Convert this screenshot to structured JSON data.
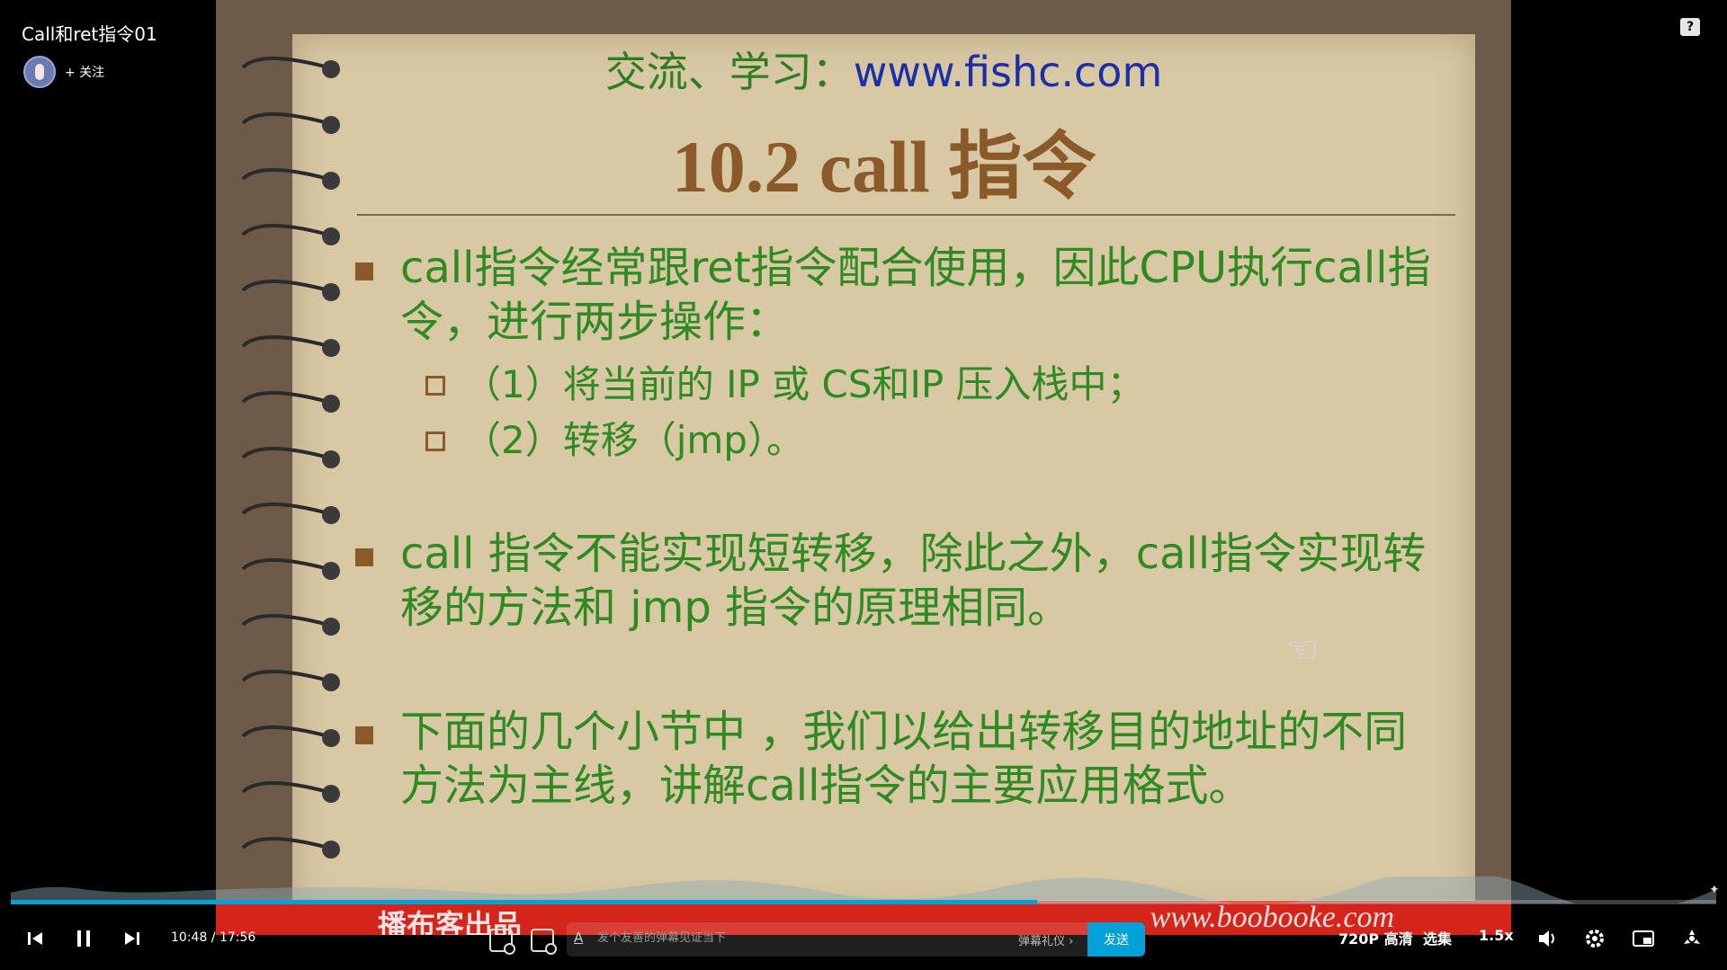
{
  "player": {
    "video_title": "Call和ret指令01",
    "follow_label": "+ 关注",
    "help_label": "?"
  },
  "slide": {
    "site_prefix": "交流、学习：",
    "site_url": "www.fishc.com",
    "heading": "10.2 call 指令",
    "bullets": [
      "call指令经常跟ret指令配合使用，因此CPU执行call指令，进行两步操作：",
      "call 指令不能实现短转移，除此之外，call指令实现转移的方法和 jmp 指令的原理相同。",
      "下面的几个小节中 ，我们以给出转移目的地址的不同方法为主线，讲解call指令的主要应用格式。"
    ],
    "sub_items": [
      "（1）将当前的 IP  或  CS和IP 压入栈中；",
      "（2）转移（jmp）。"
    ],
    "banner_left": "播布客出品",
    "banner_right": "www.boobooke.com"
  },
  "progress": {
    "current_time": "10:48",
    "separator": "/",
    "total_time": "17:56",
    "fraction": 0.602
  },
  "danmu": {
    "placeholder": "发个友善的弹幕见证当下",
    "etiquette_label": "弹幕礼仪 ›",
    "send_label": "发送",
    "a_icon": "A"
  },
  "controls": {
    "quality": "720P 高清",
    "episodes": "选集",
    "speed": "1.5x"
  },
  "colors": {
    "accent": "#00a1d6",
    "banner": "#d5251b",
    "slide_text": "#2f8a22",
    "slide_heading": "#8a5a2a"
  }
}
